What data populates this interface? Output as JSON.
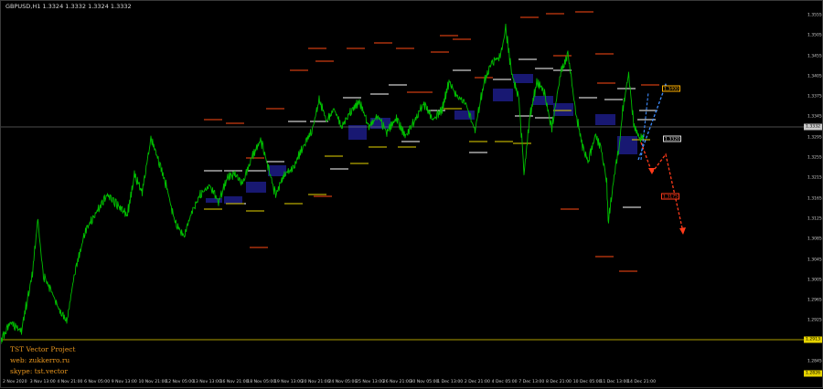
{
  "symbol_info": "GBPUSD,H1  1.3324 1.3332 1.3324 1.3332",
  "price_axis": {
    "ticks": [
      "1.3555",
      "1.3505",
      "1.3455",
      "1.3405",
      "1.3375",
      "1.3345",
      "1.3295",
      "1.3255",
      "1.3215",
      "1.3165",
      "1.3125",
      "1.3085",
      "1.3045",
      "1.3005",
      "1.2965",
      "1.2925",
      "1.2885",
      "1.2845"
    ]
  },
  "time_axis": {
    "ticks": [
      "2 Nov 2020",
      "3 Nov 13:00",
      "4 Nov 21:00",
      "6 Nov 05:00",
      "9 Nov 13:00",
      "10 Nov 21:00",
      "12 Nov 05:00",
      "13 Nov 13:00",
      "16 Nov 21:00",
      "18 Nov 05:00",
      "19 Nov 13:00",
      "20 Nov 21:00",
      "24 Nov 05:00",
      "25 Nov 13:00",
      "26 Nov 21:00",
      "30 Nov 05:00",
      "1 Dec 13:00",
      "2 Dec 21:00",
      "4 Dec 05:00",
      "7 Dec 13:00",
      "8 Dec 21:00",
      "10 Dec 05:00",
      "11 Dec 13:00",
      "14 Dec 21:00"
    ]
  },
  "badges": {
    "current_price": "1.3332",
    "current_price_box": "1.3320",
    "support_low": "1.2913",
    "bottom_price": "1.2826"
  },
  "level_tags": {
    "upper_target": "1.3400",
    "lower_target": "1.3175"
  },
  "watermark": {
    "line1": "TST Vector Project",
    "line2": "web: zukkerro.ru",
    "line3": "skype: tst.vector"
  },
  "colors": {
    "background": "#000000",
    "candles": "#00c000",
    "resistance_level": "#ff4a14",
    "white_level": "#ffffff",
    "yellow_level": "#e6d300",
    "zone_box": "#191978",
    "current_price_line": "#9a9a9a",
    "support_line": "#e6d300",
    "up_arrow": "#3d8cff",
    "down_arrow": "#ff3a1a",
    "watermark": "#e8961e"
  }
}
